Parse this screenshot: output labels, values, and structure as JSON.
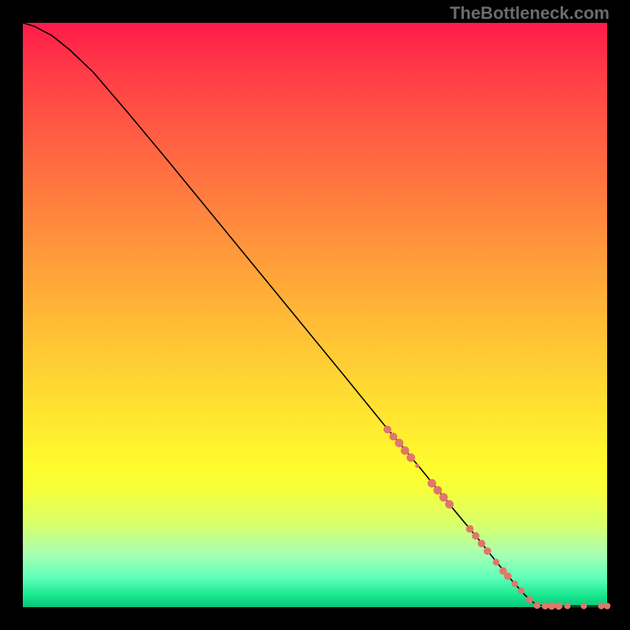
{
  "watermark": "TheBottleneck.com",
  "chart_data": {
    "type": "line",
    "title": "",
    "xlabel": "",
    "ylabel": "",
    "xlim": [
      0,
      100
    ],
    "ylim": [
      0,
      100
    ],
    "grid": false,
    "curve": [
      {
        "x": 0.0,
        "y": 100.0
      },
      {
        "x": 2.0,
        "y": 99.4
      },
      {
        "x": 5.0,
        "y": 97.8
      },
      {
        "x": 8.0,
        "y": 95.4
      },
      {
        "x": 12.0,
        "y": 91.6
      },
      {
        "x": 18.0,
        "y": 84.6
      },
      {
        "x": 25.0,
        "y": 76.2
      },
      {
        "x": 35.0,
        "y": 64.0
      },
      {
        "x": 45.0,
        "y": 51.8
      },
      {
        "x": 55.0,
        "y": 39.6
      },
      {
        "x": 62.0,
        "y": 31.0
      },
      {
        "x": 68.0,
        "y": 23.8
      },
      {
        "x": 74.0,
        "y": 16.4
      },
      {
        "x": 78.0,
        "y": 11.6
      },
      {
        "x": 81.0,
        "y": 7.8
      },
      {
        "x": 84.0,
        "y": 4.2
      },
      {
        "x": 86.0,
        "y": 2.0
      },
      {
        "x": 87.5,
        "y": 0.7
      },
      {
        "x": 89.0,
        "y": 0.2
      },
      {
        "x": 92.0,
        "y": 0.2
      },
      {
        "x": 96.0,
        "y": 0.2
      },
      {
        "x": 100.0,
        "y": 0.2
      }
    ],
    "markers": [
      {
        "x": 62.4,
        "y": 30.4,
        "r": 5.0
      },
      {
        "x": 63.4,
        "y": 29.2,
        "r": 5.0
      },
      {
        "x": 64.4,
        "y": 28.1,
        "r": 5.4
      },
      {
        "x": 65.4,
        "y": 26.8,
        "r": 5.4
      },
      {
        "x": 66.4,
        "y": 25.6,
        "r": 5.4
      },
      {
        "x": 67.5,
        "y": 24.2,
        "r": 2.6
      },
      {
        "x": 70.0,
        "y": 21.2,
        "r": 5.4
      },
      {
        "x": 71.0,
        "y": 20.0,
        "r": 5.4
      },
      {
        "x": 72.0,
        "y": 18.8,
        "r": 5.4
      },
      {
        "x": 73.0,
        "y": 17.6,
        "r": 5.4
      },
      {
        "x": 76.5,
        "y": 13.4,
        "r": 4.8
      },
      {
        "x": 77.5,
        "y": 12.2,
        "r": 4.8
      },
      {
        "x": 78.5,
        "y": 10.9,
        "r": 4.8
      },
      {
        "x": 79.5,
        "y": 9.6,
        "r": 4.8
      },
      {
        "x": 81.0,
        "y": 7.7,
        "r": 4.2
      },
      {
        "x": 82.2,
        "y": 6.2,
        "r": 4.8
      },
      {
        "x": 83.0,
        "y": 5.3,
        "r": 4.8
      },
      {
        "x": 84.2,
        "y": 4.0,
        "r": 4.2
      },
      {
        "x": 85.3,
        "y": 2.8,
        "r": 4.2
      },
      {
        "x": 86.7,
        "y": 1.3,
        "r": 4.4
      },
      {
        "x": 88.0,
        "y": 0.3,
        "r": 4.4
      },
      {
        "x": 89.4,
        "y": 0.2,
        "r": 4.4
      },
      {
        "x": 90.5,
        "y": 0.2,
        "r": 4.8
      },
      {
        "x": 91.7,
        "y": 0.2,
        "r": 4.8
      },
      {
        "x": 93.2,
        "y": 0.2,
        "r": 4.0
      },
      {
        "x": 96.0,
        "y": 0.2,
        "r": 4.0
      },
      {
        "x": 99.0,
        "y": 0.2,
        "r": 4.2
      },
      {
        "x": 100.0,
        "y": 0.2,
        "r": 4.2
      }
    ],
    "marker_color": "#e07769",
    "background_style": "vertical-gradient-rainbow"
  }
}
